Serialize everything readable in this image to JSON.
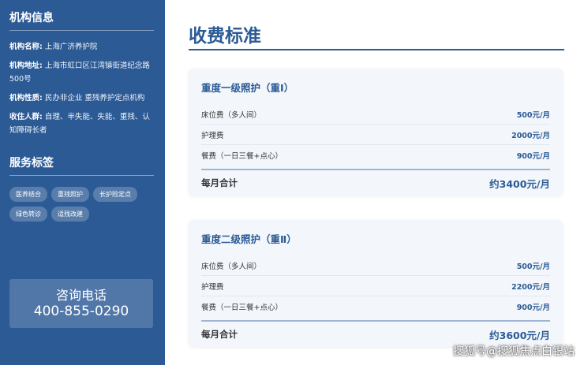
{
  "sidebar": {
    "info_title": "机构信息",
    "info": [
      {
        "key": "机构名称:",
        "value": "上海广济养护院"
      },
      {
        "key": "机构地址:",
        "value": "上海市虹口区江湾镇街道纪念路500号"
      },
      {
        "key": "机构性质:",
        "value": "民办非企业 重残养护定点机构"
      },
      {
        "key": "收住人群:",
        "value": "自理、半失能、失能、重残、认知障碍长者"
      }
    ],
    "tags_title": "服务标签",
    "tags": [
      "医养结合",
      "重残照护",
      "长护险定点",
      "绿色转诊",
      "适残改建"
    ],
    "phone_label": "咨询电话",
    "phone_number": "400-855-0290"
  },
  "main": {
    "title": "收费标准",
    "cards": [
      {
        "title": "重度一级照护（重Ⅰ）",
        "rows": [
          {
            "name": "床位费（多人间）",
            "price": "500元/月"
          },
          {
            "name": "护理费",
            "price": "2000元/月"
          },
          {
            "name": "餐费（一日三餐+点心）",
            "price": "900元/月"
          }
        ],
        "total_label": "每月合计",
        "total_value": "约3400元/月"
      },
      {
        "title": "重度二级照护（重Ⅱ）",
        "rows": [
          {
            "name": "床位费（多人间）",
            "price": "500元/月"
          },
          {
            "name": "护理费",
            "price": "2200元/月"
          },
          {
            "name": "餐费（一日三餐+点心）",
            "price": "900元/月"
          }
        ],
        "total_label": "每月合计",
        "total_value": "约3600元/月"
      }
    ]
  },
  "watermark": "搜狐号@搜狐焦点白银站"
}
